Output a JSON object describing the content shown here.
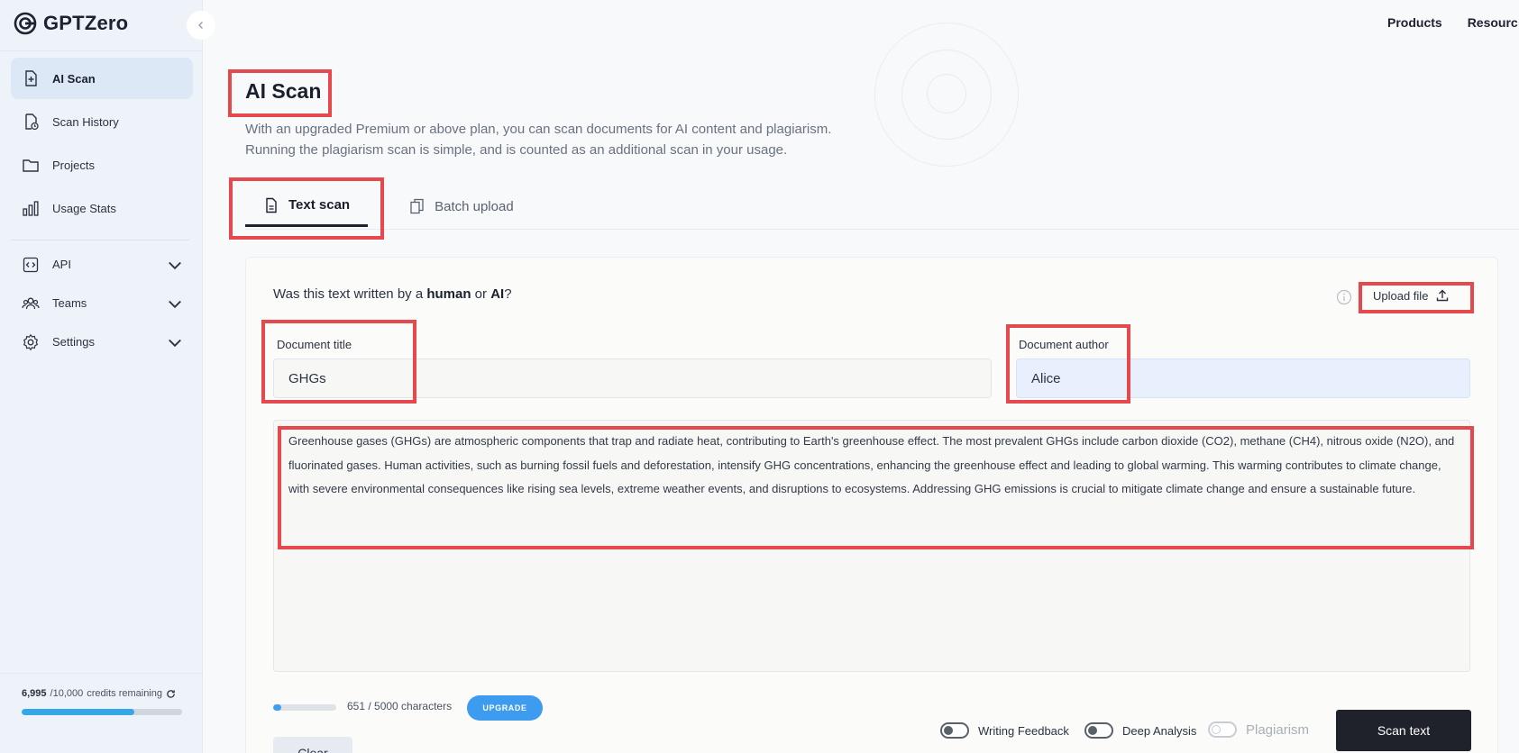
{
  "app": {
    "name": "GPTZero"
  },
  "sidebar": {
    "items": [
      {
        "label": "AI Scan",
        "icon": "file-plus-icon",
        "active": true
      },
      {
        "label": "Scan History",
        "icon": "file-clock-icon",
        "active": false
      },
      {
        "label": "Projects",
        "icon": "folder-icon",
        "active": false
      },
      {
        "label": "Usage Stats",
        "icon": "bar-chart-icon",
        "active": false
      }
    ],
    "groups": [
      {
        "label": "API",
        "icon": "code-icon"
      },
      {
        "label": "Teams",
        "icon": "users-icon"
      },
      {
        "label": "Settings",
        "icon": "gear-icon"
      }
    ],
    "credits": {
      "used": "6,995",
      "total": "/10,000",
      "suffix": "credits remaining",
      "fraction": 0.6995
    }
  },
  "topnav": {
    "products": "Products",
    "resources": "Resourc"
  },
  "page": {
    "title": "AI Scan",
    "description_1": "With an upgraded Premium or above plan, you can scan documents for AI content and plagiarism.",
    "description_2": "Running the plagiarism scan is simple, and is counted as an additional scan in your usage."
  },
  "tabs": [
    {
      "label": "Text scan",
      "active": true
    },
    {
      "label": "Batch upload",
      "active": false
    }
  ],
  "form": {
    "question_prefix": "Was this text written by a ",
    "question_human": "human",
    "question_or": " or ",
    "question_ai": "AI",
    "question_suffix": "?",
    "upload_label": "Upload file",
    "title_label": "Document title",
    "title_value": "GHGs",
    "author_label": "Document author",
    "author_value": "Alice",
    "text_value": "Greenhouse gases (GHGs) are atmospheric components that trap and radiate heat, contributing to Earth's greenhouse effect. The most prevalent GHGs include carbon dioxide (CO2), methane (CH4), nitrous oxide (N2O), and fluorinated gases. Human activities, such as burning fossil fuels and deforestation, intensify GHG concentrations, enhancing the greenhouse effect and leading to global warming. This warming contributes to climate change, with severe environmental consequences like rising sea levels, extreme weather events, and disruptions to ecosystems. Addressing GHG emissions is crucial to mitigate climate change and ensure a sustainable future.",
    "char_count": "651 / 5000 characters",
    "char_fraction": 0.1302,
    "upgrade_label": "UPGRADE",
    "toggles": {
      "writing_feedback": "Writing Feedback",
      "deep_analysis": "Deep Analysis",
      "plagiarism": "Plagiarism"
    },
    "scan_label": "Scan text",
    "clear_label": "Clear"
  },
  "colors": {
    "highlight": "#e5484d",
    "accent": "#3d9bf0",
    "dark_button": "#1f222b"
  }
}
